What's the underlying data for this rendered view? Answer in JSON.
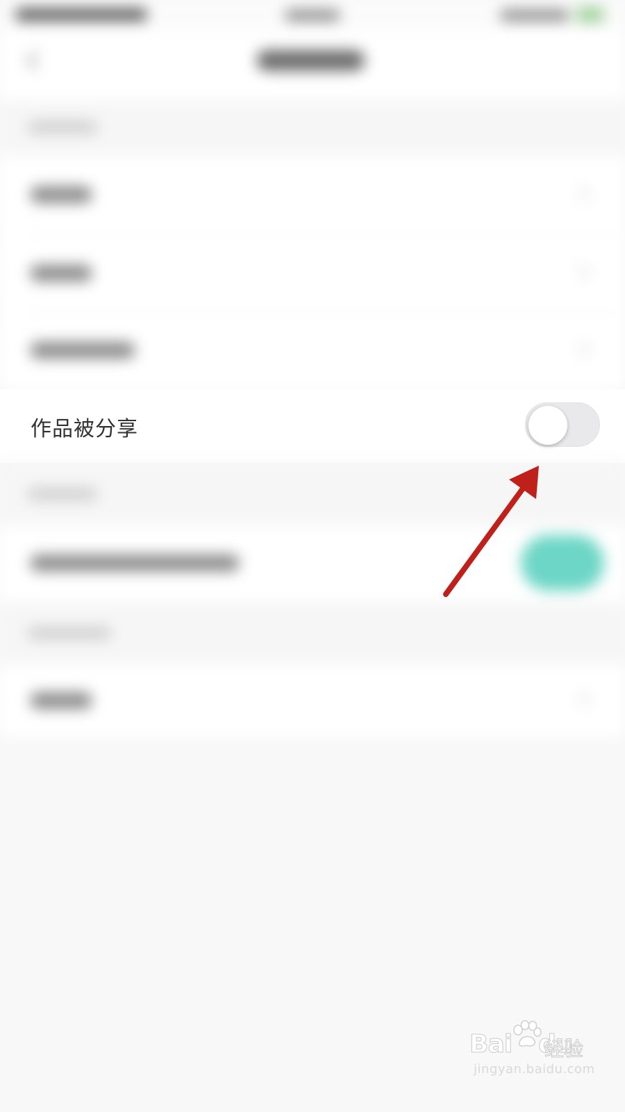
{
  "settings": {
    "share_row": {
      "label": "作品被分享",
      "toggle_on": false
    }
  },
  "colors": {
    "toggle_off_track": "#e9e9ec",
    "toggle_on_track": "#6dd6c6",
    "arrow": "#c0201a"
  },
  "watermark": {
    "brand": "Bai",
    "brand_suffix": "du",
    "jingyan": "经验",
    "url": "jingyan.baidu.com"
  },
  "icons": {
    "back": "chevron-left-icon",
    "row_chevron": "chevron-right-icon",
    "watermark_paw": "paw-icon"
  }
}
